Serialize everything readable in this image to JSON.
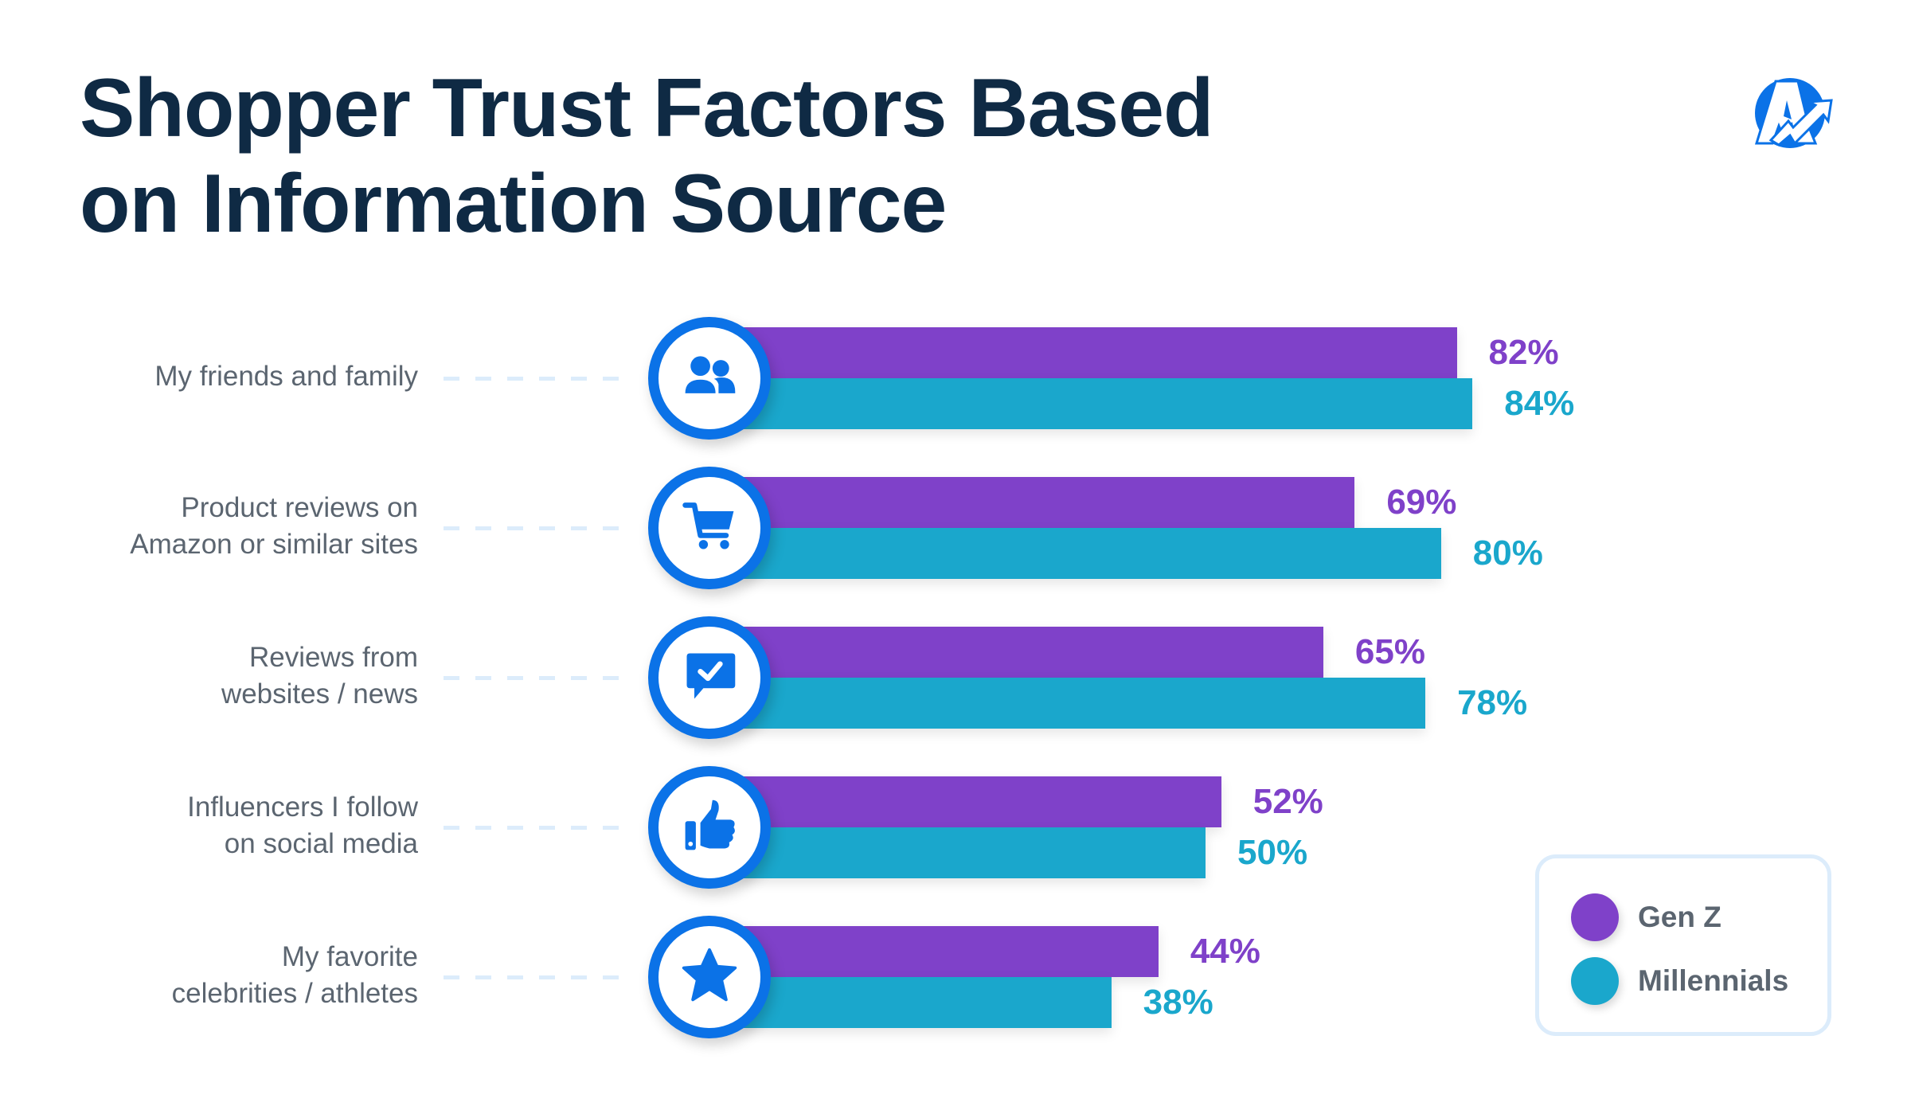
{
  "header": {
    "title_line1": "Shopper Trust Factors Based",
    "title_line2": "on Information Source",
    "logo_icon": "brand-a-arrow-logo"
  },
  "colors": {
    "genz": "#7f41c9",
    "millennials": "#1aa7cc",
    "icon_blue": "#0b72e7",
    "title": "#0f2a44",
    "label": "#5b6570"
  },
  "chart_data": {
    "type": "bar",
    "orientation": "horizontal",
    "title": "Shopper Trust Factors Based on Information Source",
    "xlabel": "",
    "ylabel": "",
    "unit": "%",
    "categories": [
      "My friends and family",
      "Product reviews on Amazon or similar sites",
      "Reviews from websites / news",
      "Influencers I follow on social media",
      "My favorite celebrities / athletes"
    ],
    "category_lines": [
      [
        "My friends and family"
      ],
      [
        "Product reviews on",
        "Amazon or similar sites"
      ],
      [
        "Reviews from",
        "websites / news"
      ],
      [
        "Influencers I follow",
        "on social media"
      ],
      [
        "My favorite",
        "celebrities / athletes"
      ]
    ],
    "category_icons": [
      "people-icon",
      "shopping-cart-icon",
      "chat-check-icon",
      "thumbs-up-icon",
      "star-icon"
    ],
    "series": [
      {
        "name": "Gen Z",
        "values": [
          82,
          69,
          65,
          52,
          44
        ],
        "labels": [
          "82%",
          "69%",
          "65%",
          "52%",
          "44%"
        ]
      },
      {
        "name": "Millennials",
        "values": [
          84,
          80,
          78,
          50,
          38
        ],
        "labels": [
          "84%",
          "80%",
          "78%",
          "50%",
          "38%"
        ]
      }
    ],
    "xlim": [
      0,
      100
    ],
    "grid": false,
    "legend": {
      "position": "bottom-right",
      "entries": [
        "Gen Z",
        "Millennials"
      ]
    }
  }
}
